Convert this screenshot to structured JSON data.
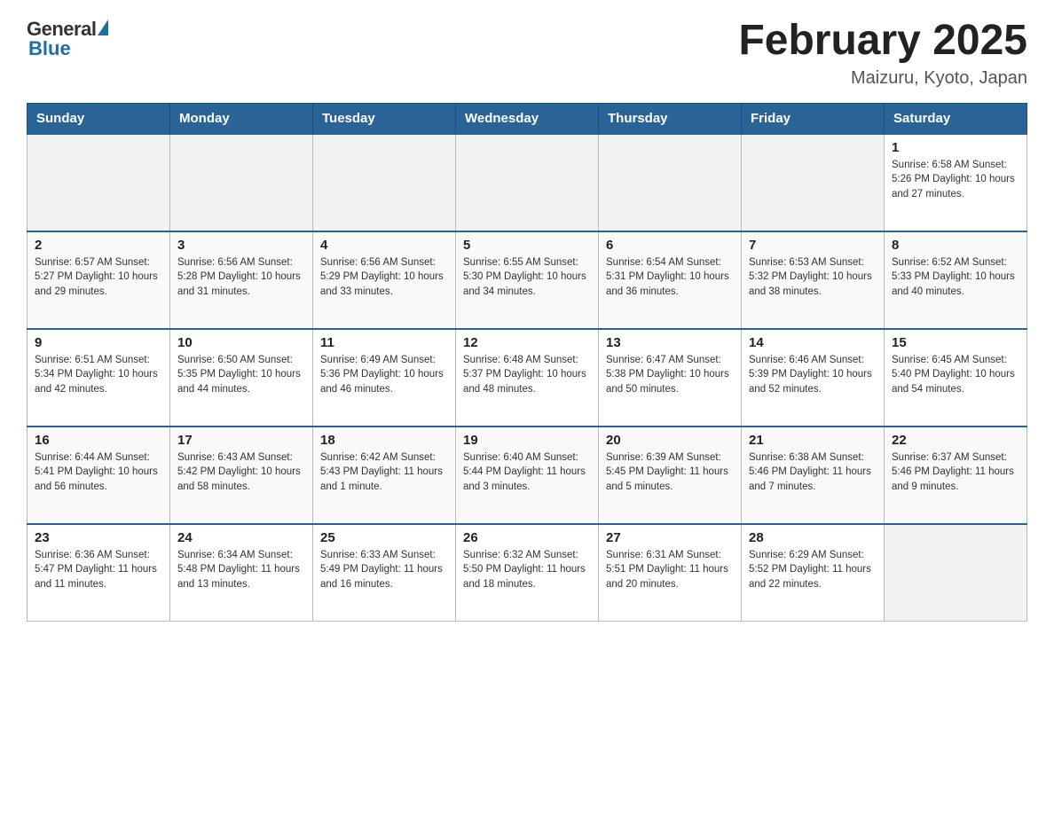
{
  "logo": {
    "general": "General",
    "blue": "Blue"
  },
  "header": {
    "title": "February 2025",
    "subtitle": "Maizuru, Kyoto, Japan"
  },
  "weekdays": [
    "Sunday",
    "Monday",
    "Tuesday",
    "Wednesday",
    "Thursday",
    "Friday",
    "Saturday"
  ],
  "weeks": [
    [
      {
        "day": "",
        "info": ""
      },
      {
        "day": "",
        "info": ""
      },
      {
        "day": "",
        "info": ""
      },
      {
        "day": "",
        "info": ""
      },
      {
        "day": "",
        "info": ""
      },
      {
        "day": "",
        "info": ""
      },
      {
        "day": "1",
        "info": "Sunrise: 6:58 AM\nSunset: 5:26 PM\nDaylight: 10 hours\nand 27 minutes."
      }
    ],
    [
      {
        "day": "2",
        "info": "Sunrise: 6:57 AM\nSunset: 5:27 PM\nDaylight: 10 hours\nand 29 minutes."
      },
      {
        "day": "3",
        "info": "Sunrise: 6:56 AM\nSunset: 5:28 PM\nDaylight: 10 hours\nand 31 minutes."
      },
      {
        "day": "4",
        "info": "Sunrise: 6:56 AM\nSunset: 5:29 PM\nDaylight: 10 hours\nand 33 minutes."
      },
      {
        "day": "5",
        "info": "Sunrise: 6:55 AM\nSunset: 5:30 PM\nDaylight: 10 hours\nand 34 minutes."
      },
      {
        "day": "6",
        "info": "Sunrise: 6:54 AM\nSunset: 5:31 PM\nDaylight: 10 hours\nand 36 minutes."
      },
      {
        "day": "7",
        "info": "Sunrise: 6:53 AM\nSunset: 5:32 PM\nDaylight: 10 hours\nand 38 minutes."
      },
      {
        "day": "8",
        "info": "Sunrise: 6:52 AM\nSunset: 5:33 PM\nDaylight: 10 hours\nand 40 minutes."
      }
    ],
    [
      {
        "day": "9",
        "info": "Sunrise: 6:51 AM\nSunset: 5:34 PM\nDaylight: 10 hours\nand 42 minutes."
      },
      {
        "day": "10",
        "info": "Sunrise: 6:50 AM\nSunset: 5:35 PM\nDaylight: 10 hours\nand 44 minutes."
      },
      {
        "day": "11",
        "info": "Sunrise: 6:49 AM\nSunset: 5:36 PM\nDaylight: 10 hours\nand 46 minutes."
      },
      {
        "day": "12",
        "info": "Sunrise: 6:48 AM\nSunset: 5:37 PM\nDaylight: 10 hours\nand 48 minutes."
      },
      {
        "day": "13",
        "info": "Sunrise: 6:47 AM\nSunset: 5:38 PM\nDaylight: 10 hours\nand 50 minutes."
      },
      {
        "day": "14",
        "info": "Sunrise: 6:46 AM\nSunset: 5:39 PM\nDaylight: 10 hours\nand 52 minutes."
      },
      {
        "day": "15",
        "info": "Sunrise: 6:45 AM\nSunset: 5:40 PM\nDaylight: 10 hours\nand 54 minutes."
      }
    ],
    [
      {
        "day": "16",
        "info": "Sunrise: 6:44 AM\nSunset: 5:41 PM\nDaylight: 10 hours\nand 56 minutes."
      },
      {
        "day": "17",
        "info": "Sunrise: 6:43 AM\nSunset: 5:42 PM\nDaylight: 10 hours\nand 58 minutes."
      },
      {
        "day": "18",
        "info": "Sunrise: 6:42 AM\nSunset: 5:43 PM\nDaylight: 11 hours\nand 1 minute."
      },
      {
        "day": "19",
        "info": "Sunrise: 6:40 AM\nSunset: 5:44 PM\nDaylight: 11 hours\nand 3 minutes."
      },
      {
        "day": "20",
        "info": "Sunrise: 6:39 AM\nSunset: 5:45 PM\nDaylight: 11 hours\nand 5 minutes."
      },
      {
        "day": "21",
        "info": "Sunrise: 6:38 AM\nSunset: 5:46 PM\nDaylight: 11 hours\nand 7 minutes."
      },
      {
        "day": "22",
        "info": "Sunrise: 6:37 AM\nSunset: 5:46 PM\nDaylight: 11 hours\nand 9 minutes."
      }
    ],
    [
      {
        "day": "23",
        "info": "Sunrise: 6:36 AM\nSunset: 5:47 PM\nDaylight: 11 hours\nand 11 minutes."
      },
      {
        "day": "24",
        "info": "Sunrise: 6:34 AM\nSunset: 5:48 PM\nDaylight: 11 hours\nand 13 minutes."
      },
      {
        "day": "25",
        "info": "Sunrise: 6:33 AM\nSunset: 5:49 PM\nDaylight: 11 hours\nand 16 minutes."
      },
      {
        "day": "26",
        "info": "Sunrise: 6:32 AM\nSunset: 5:50 PM\nDaylight: 11 hours\nand 18 minutes."
      },
      {
        "day": "27",
        "info": "Sunrise: 6:31 AM\nSunset: 5:51 PM\nDaylight: 11 hours\nand 20 minutes."
      },
      {
        "day": "28",
        "info": "Sunrise: 6:29 AM\nSunset: 5:52 PM\nDaylight: 11 hours\nand 22 minutes."
      },
      {
        "day": "",
        "info": ""
      }
    ]
  ]
}
